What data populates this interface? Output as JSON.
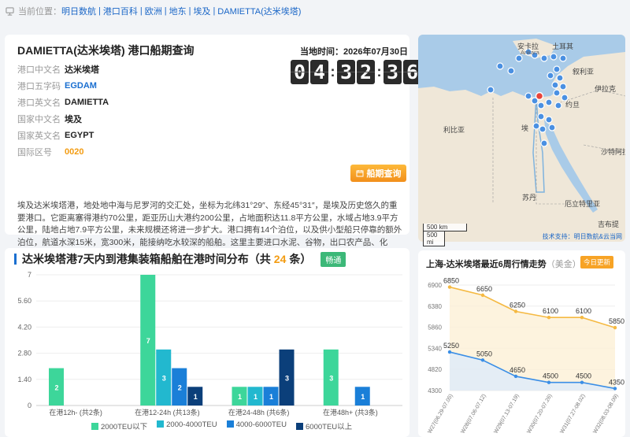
{
  "breadcrumb": {
    "prefix": "当前位置：",
    "items": [
      "明日数航",
      "港口百科",
      "欧洲",
      "地东",
      "埃及",
      "DAMIETTA(达米埃塔)"
    ]
  },
  "info": {
    "title": "DAMIETTA(达米埃塔) 港口船期查询",
    "fields": [
      {
        "label": "港口中文名",
        "value": "达米埃塔"
      },
      {
        "label": "港口五字码",
        "value": "EGDAM"
      },
      {
        "label": "港口英文名",
        "value": "DAMIETTA"
      },
      {
        "label": "国家中文名",
        "value": "埃及"
      },
      {
        "label": "国家英文名",
        "value": "EGYPT"
      },
      {
        "label": "国际区号",
        "value": "0020"
      }
    ],
    "clock_label": "当地时间：2026年07月30日",
    "clock_digits": [
      "0",
      "4",
      "3",
      "2",
      "3",
      "6"
    ],
    "query_button": "船期查询",
    "description": "埃及达米埃塔港，地处地中海与尼罗河的交汇处，坐标为北纬31°29″、东经45°31″，是埃及历史悠久的重要港口。它距离塞得港约70公里，距亚历山大港约200公里，占地面积达11.8平方公里，水域占地3.9平方公里，陆地占地7.9平方公里，未来规模还将进一步扩大。港口拥有14个泊位，以及供小型船只停靠的额外泊位，航道水深15米，宽300米，能接纳吃水较深的船舶。这里主要进口水泥、谷物，出口农产品、化肥、家具等货物。港口还提供包括加油、船舶维修、货物装卸等在内的全面服务，有力推动着埃及的贸易往来与经济发展。"
  },
  "map": {
    "labels": [
      "土耳其",
      "Ankara",
      "安卡拉",
      "叙利亚",
      "伊拉克",
      "约旦",
      "利比亚",
      "埃",
      "沙特阿拉",
      "苏丹",
      "厄立特里亚",
      "吉布提"
    ],
    "scale_km": "500 km",
    "scale_mi": "500 mi",
    "credit": "技术支持：明日数航&云当网"
  },
  "chart_data": {
    "type": "bar",
    "title_prefix": "达米埃塔港7天内到港集装箱船舶在港时间分布（共",
    "title_count": "24",
    "title_suffix": "条）",
    "badge": "畅通",
    "categories": [
      "在港12h- (共2条)",
      "在港12-24h (共13条)",
      "在港24-48h (共6条)",
      "在港48h+ (共3条)"
    ],
    "series": [
      {
        "name": "2000TEU以下",
        "color": "#3dd69a",
        "values": [
          2,
          7,
          1,
          3
        ]
      },
      {
        "name": "2000-4000TEU",
        "color": "#22b8cf",
        "values": [
          0,
          3,
          1,
          0
        ]
      },
      {
        "name": "4000-6000TEU",
        "color": "#1a7fd8",
        "values": [
          0,
          2,
          1,
          1
        ]
      },
      {
        "name": "6000TEU以上",
        "color": "#0b3f7a",
        "values": [
          0,
          1,
          3,
          0
        ]
      }
    ],
    "yticks": [
      "0",
      "1.40",
      "2.80",
      "4.20",
      "5.60",
      "7"
    ],
    "ylim": [
      0,
      7
    ]
  },
  "trend": {
    "title": "上海-达米埃塔最近6周行情走势",
    "unit": "（美金）",
    "badge": "今日更新",
    "x": [
      "W27(06.29-07.05)",
      "W28(07.06-07.12)",
      "W29(07.13-07.19)",
      "W30(07.20-07.26)",
      "W31(07.27-08.02)",
      "W32(08.03-08.09)"
    ],
    "series": [
      {
        "color": "#f5b942",
        "values": [
          6850,
          6650,
          6250,
          6100,
          6100,
          5850
        ]
      },
      {
        "color": "#3a8ee6",
        "values": [
          5250,
          5050,
          4650,
          4500,
          4500,
          4350
        ]
      }
    ],
    "yticks": [
      "4300",
      "4820",
      "5340",
      "5860",
      "6380",
      "6900"
    ],
    "ylim": [
      4300,
      6900
    ]
  }
}
